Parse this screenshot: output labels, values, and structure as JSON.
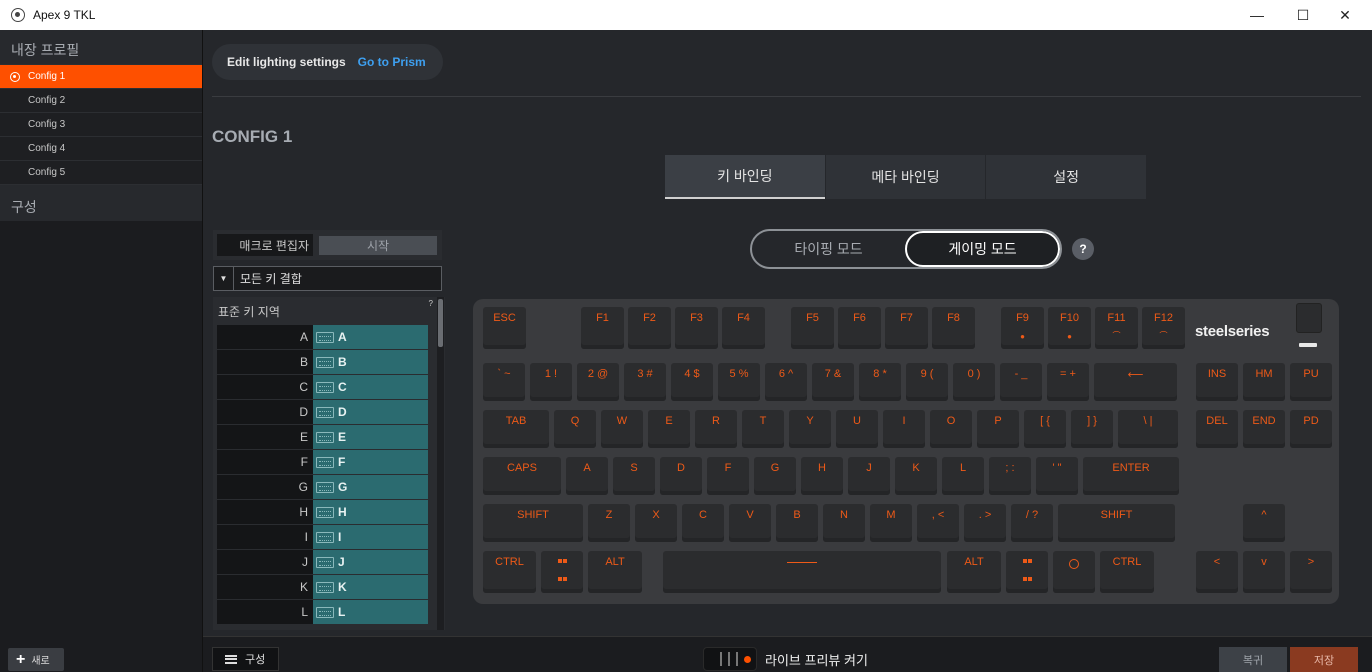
{
  "window": {
    "title": "Apex 9 TKL"
  },
  "sidebar": {
    "profiles_heading": "내장 프로필",
    "configs": [
      "Config 1",
      "Config 2",
      "Config 3",
      "Config 4",
      "Config 5"
    ],
    "active_config": "Config 1",
    "section_heading": "구성",
    "new_button": "새로"
  },
  "header": {
    "edit_label": "Edit lighting settings",
    "prism_link": "Go to Prism"
  },
  "config_title": "CONFIG 1",
  "tabs": [
    "키 바인딩",
    "메타 바인딩",
    "설정"
  ],
  "active_tab": "키 바인딩",
  "modes": {
    "typing": "타이핑 모드",
    "gaming": "게이밍 모드",
    "active": "게이밍 모드",
    "help": "?"
  },
  "macro": {
    "editor_label": "매크로 편집자",
    "start_button": "시작"
  },
  "key_combo": {
    "selected": "모든 키 결합"
  },
  "key_list": {
    "heading": "표준 키 지역",
    "help": "?",
    "rows": [
      {
        "key": "A",
        "binding": "A"
      },
      {
        "key": "B",
        "binding": "B"
      },
      {
        "key": "C",
        "binding": "C"
      },
      {
        "key": "D",
        "binding": "D"
      },
      {
        "key": "E",
        "binding": "E"
      },
      {
        "key": "F",
        "binding": "F"
      },
      {
        "key": "G",
        "binding": "G"
      },
      {
        "key": "H",
        "binding": "H"
      },
      {
        "key": "I",
        "binding": "I"
      },
      {
        "key": "J",
        "binding": "J"
      },
      {
        "key": "K",
        "binding": "K"
      },
      {
        "key": "L",
        "binding": "L"
      }
    ]
  },
  "keyboard": {
    "brand": "steelseries",
    "accent_color": "#ee5a18",
    "rows": [
      [
        "ESC",
        "F1",
        "F2",
        "F3",
        "F4",
        "F5",
        "F6",
        "F7",
        "F8",
        "F9",
        "F10",
        "F11",
        "F12"
      ],
      [
        "` ~",
        "1 !",
        "2 @",
        "3 #",
        "4 $",
        "5 %",
        "6 ^",
        "7 &",
        "8 *",
        "9 (",
        "0 )",
        "- _",
        "= +",
        "⟵",
        "INS",
        "HM",
        "PU"
      ],
      [
        "TAB",
        "Q",
        "W",
        "E",
        "R",
        "T",
        "Y",
        "U",
        "I",
        "O",
        "P",
        "[ {",
        "] }",
        "\\ |",
        "DEL",
        "END",
        "PD"
      ],
      [
        "CAPS",
        "A",
        "S",
        "D",
        "F",
        "G",
        "H",
        "J",
        "K",
        "L",
        "; :",
        "' \"",
        "ENTER"
      ],
      [
        "SHIFT",
        "Z",
        "X",
        "C",
        "V",
        "B",
        "N",
        "M",
        ", <",
        ". >",
        "/ ?",
        "SHIFT",
        "^"
      ],
      [
        "CTRL",
        "windows-icon",
        "ALT",
        "space",
        "ALT",
        "windows-icon",
        "steelseries-icon",
        "CTRL",
        "<",
        "v",
        ">"
      ]
    ]
  },
  "footer": {
    "config_button": "구성",
    "live_preview": "라이브 프리뷰 켜기",
    "revert_button": "복귀",
    "save_button": "저장"
  }
}
